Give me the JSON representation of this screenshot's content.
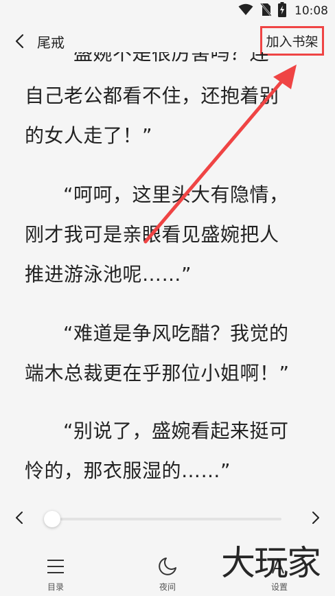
{
  "status_bar": {
    "time": "10:08",
    "icons": [
      "wifi-icon",
      "no-sim-icon",
      "battery-charging-icon"
    ]
  },
  "header": {
    "back_icon": "chevron-left-icon",
    "book_title": "尾戒",
    "add_to_shelf_label": "加入书架",
    "highlight_color": "#ef4444"
  },
  "reader": {
    "lines": [
      {
        "text": "“盛婉不是很厉害吗？连",
        "indent": true,
        "partial": true
      },
      {
        "text": "自己老公都看不住，还抱着别",
        "indent": false
      },
      {
        "text": "的女人走了！”",
        "indent": false
      },
      {
        "text": "“呵呵，这里头大有隐情，",
        "indent": true
      },
      {
        "text": "刚才我可是亲眼看见盛婉把人",
        "indent": false
      },
      {
        "text": "推进游泳池呢……”",
        "indent": false
      },
      {
        "text": "“难道是争风吃醋？我觉的",
        "indent": true
      },
      {
        "text": "端木总裁更在乎那位小姐啊！”",
        "indent": false
      },
      {
        "text": "“别说了，盛婉看起来挺可",
        "indent": true
      },
      {
        "text": "怜的，那衣服湿的……”",
        "indent": false
      }
    ]
  },
  "progress": {
    "prev_icon": "chevron-left-icon",
    "next_icon": "chevron-right-icon",
    "value": 0.0
  },
  "bottom_nav": {
    "items": [
      {
        "label": "目录",
        "icon": "menu-lines-icon"
      },
      {
        "label": "夜间",
        "icon": "moon-icon"
      },
      {
        "label": "设置",
        "icon": "font-settings-icon"
      }
    ]
  },
  "watermark": {
    "text": "大玩家"
  },
  "annotation": {
    "arrow_color": "#ef4444"
  }
}
